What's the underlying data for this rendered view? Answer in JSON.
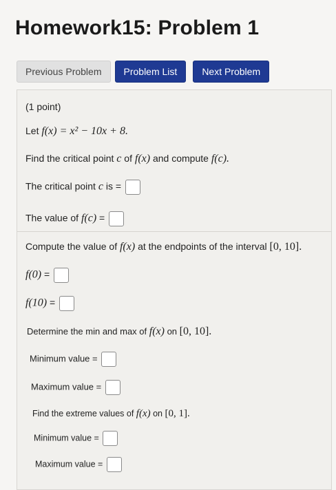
{
  "page": {
    "title": "Homework15: Problem 1"
  },
  "nav": {
    "previous_label": "Previous Problem",
    "list_label": "Problem List",
    "next_label": "Next Problem"
  },
  "problem": {
    "points": "(1 point)",
    "let_prefix": "Let ",
    "function_def": "f(x) = x² − 10x + 8.",
    "instruction_a": "Find the critical point ",
    "instruction_c": "c",
    "instruction_b": " of ",
    "instruction_fx": "f(x)",
    "instruction_d": " and compute ",
    "instruction_fc": "f(c).",
    "critical_label_a": "The critical point ",
    "critical_label_c": "c",
    "critical_label_b": " is = ",
    "value_label_a": "The value of ",
    "value_label_fc": "f(c)",
    "value_label_b": " = ",
    "endpoints_a": "Compute the value of ",
    "endpoints_fx": "f(x)",
    "endpoints_b": " at the endpoints of the interval ",
    "endpoints_interval": "[0, 10].",
    "f0_label": "f(0)",
    "f0_eq": " = ",
    "f10_label": "f(10)",
    "f10_eq": " = ",
    "minmax_a": "Determine the min and max of ",
    "minmax_fx": "f(x)",
    "minmax_b": " on ",
    "minmax_interval": "[0, 10].",
    "min1_label": "Minimum value = ",
    "max1_label": "Maximum value = ",
    "extreme_a": "Find the extreme values of ",
    "extreme_fx": "f(x)",
    "extreme_b": " on ",
    "extreme_interval": "[0, 1].",
    "min2_label": "Minimum value = ",
    "max2_label": "Maximum value = "
  }
}
